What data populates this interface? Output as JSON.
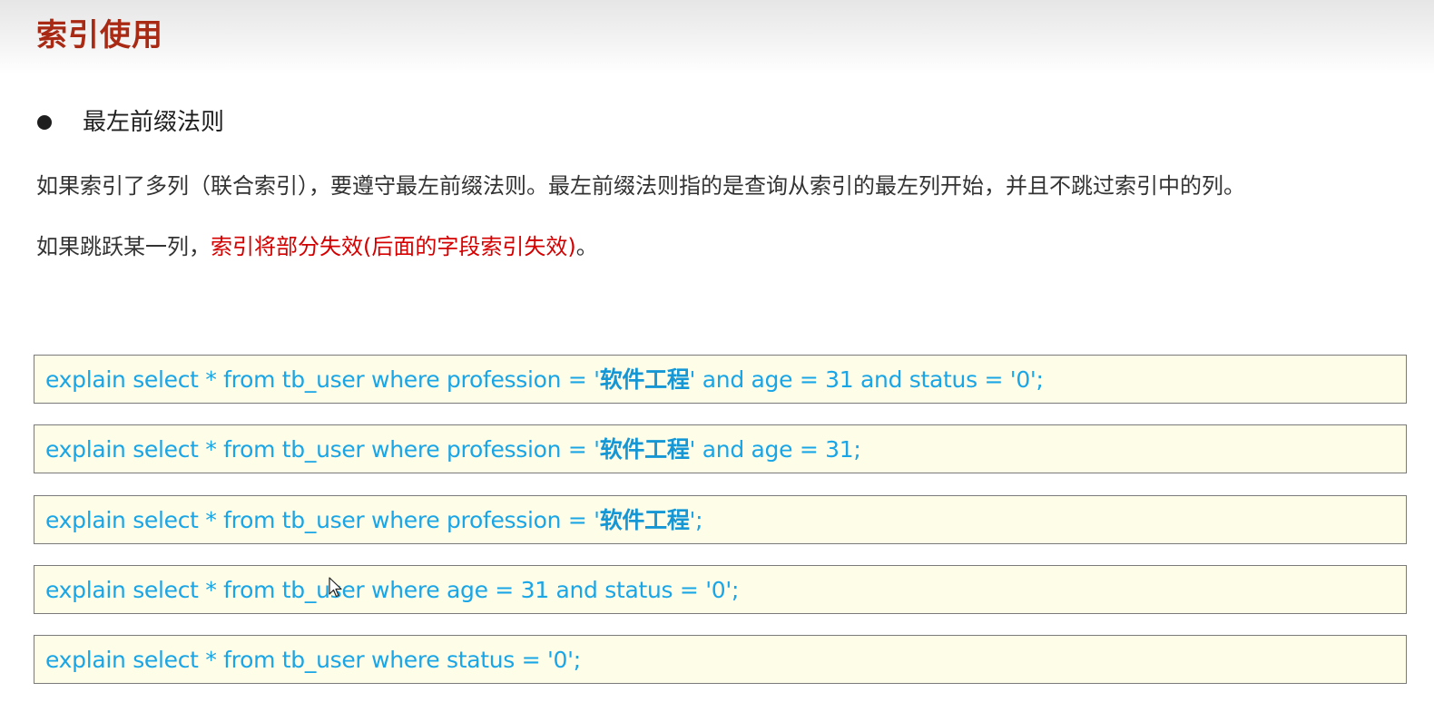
{
  "header": {
    "title": "索引使用"
  },
  "section": {
    "bullet_title": "最左前缀法则"
  },
  "paragraphs": {
    "p1": "如果索引了多列（联合索引），要遵守最左前缀法则。最左前缀法则指的是查询从索引的最左列开始，并且不跳过索引中的列。",
    "p2_prefix": "如果跳跃某一列，",
    "p2_highlight": "索引将部分失效(后面的字段索引失效)",
    "p2_suffix": "。"
  },
  "code_blocks": [
    {
      "part1": "explain select * from tb_user where profession = '",
      "lit": "软件工程",
      "part2": "' and age = 31 and status = '0';"
    },
    {
      "part1": "explain select * from tb_user where profession = '",
      "lit": "软件工程",
      "part2": "' and age = 31;"
    },
    {
      "part1": "explain select * from tb_user where profession = '",
      "lit": "软件工程",
      "part2": "';"
    },
    {
      "part1": "explain select * from tb_user where age = 31 and status = '0';",
      "lit": "",
      "part2": ""
    },
    {
      "part1": "explain select * from tb_user where status = '0';",
      "lit": "",
      "part2": ""
    }
  ],
  "colors": {
    "title": "#a92a14",
    "highlight": "#d40000",
    "code_text": "#1aa5e6",
    "code_bg": "#fefee8"
  },
  "icons": {
    "bullet": "bullet-dot-icon",
    "cursor": "mouse-pointer-icon"
  }
}
